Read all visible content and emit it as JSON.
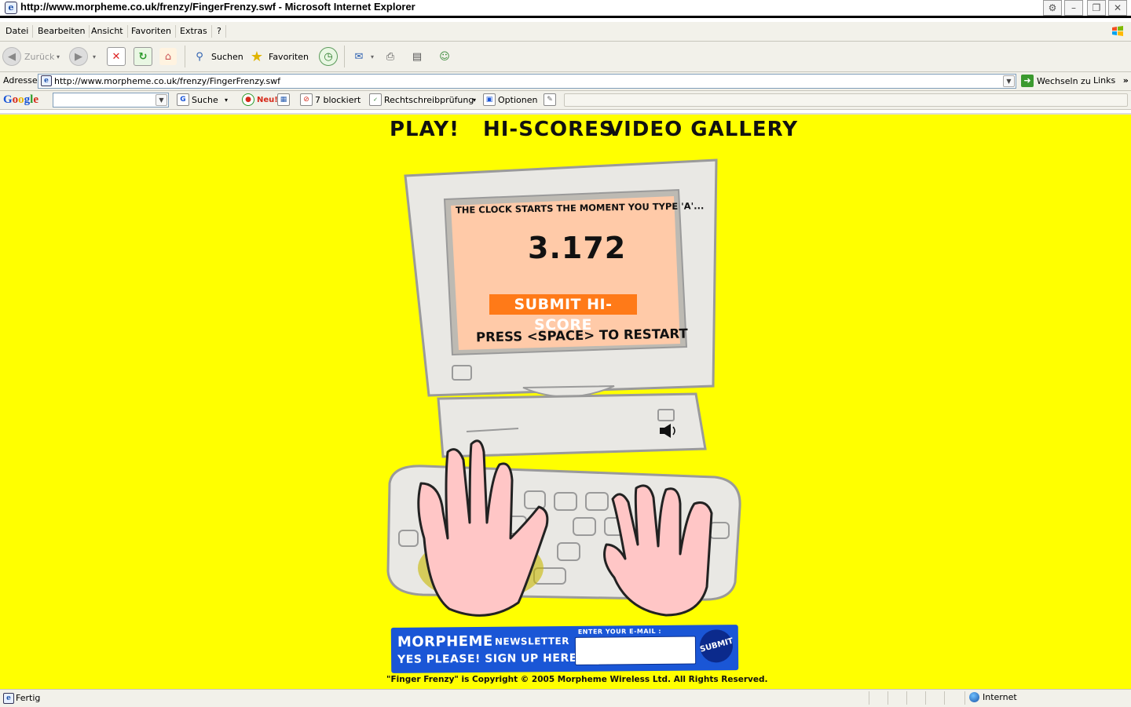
{
  "window": {
    "title": "http://www.morpheme.co.uk/frenzy/FingerFrenzy.swf - Microsoft Internet Explorer"
  },
  "menu": {
    "items": [
      "Datei",
      "Bearbeiten",
      "Ansicht",
      "Favoriten",
      "Extras",
      "?"
    ]
  },
  "toolbar": {
    "back_label": "Zurück",
    "search_label": "Suchen",
    "favorites_label": "Favoriten"
  },
  "address": {
    "label": "Adresse",
    "url": "http://www.morpheme.co.uk/frenzy/FingerFrenzy.swf",
    "go_label": "Wechseln zu",
    "links_label": "Links"
  },
  "google_toolbar": {
    "logo": "Google",
    "search_label": "Suche",
    "new_label": "Neu!",
    "blocked_label": "7 blockiert",
    "spell_label": "Rechtschreibprüfung",
    "options_label": "Optionen"
  },
  "game": {
    "nav": [
      "PLAY!",
      "HI-SCORES",
      "VIDEO GALLERY"
    ],
    "clock_message": "THE CLOCK STARTS THE MOMENT YOU TYPE 'A'...",
    "time": "3.172",
    "submit_label": "SUBMIT HI-SCORE",
    "restart_hint": "PRESS <SPACE> TO RESTART"
  },
  "newsletter": {
    "brand": "MORPHEME",
    "word": "NEWSLETTER",
    "tagline": "YES PLEASE! SIGN UP HERE...",
    "email_label": "ENTER YOUR E-MAIL :",
    "submit_label": "SUBMIT"
  },
  "footer": {
    "copyright": "\"Finger Frenzy\" is Copyright © 2005 Morpheme Wireless Ltd. All Rights Reserved."
  },
  "status": {
    "text": "Fertig",
    "zone": "Internet"
  }
}
